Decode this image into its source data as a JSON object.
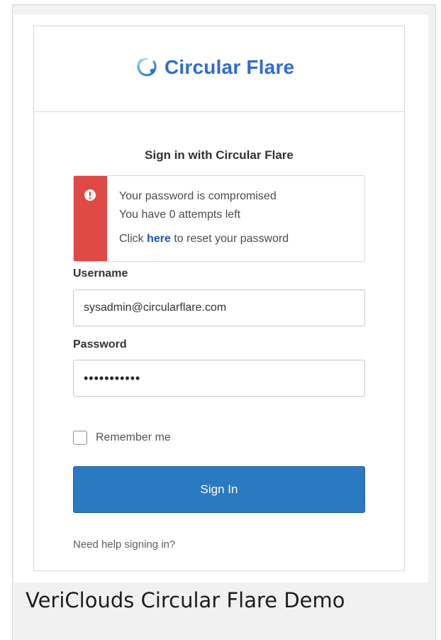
{
  "brand": {
    "logo_name": "Circular Flare",
    "logo_color": "#2f6cd3",
    "logo_icon": "circular-flare-logo-icon"
  },
  "signin": {
    "title": "Sign in with Circular Flare",
    "alert": {
      "icon": "alert-exclamation-icon",
      "accent_color": "#e04a46",
      "line1": "Your password is compromised",
      "line2": "You have 0 attempts left",
      "line3_prefix": "Click ",
      "line3_link": "here",
      "line3_suffix": " to reset your password"
    },
    "username_label": "Username",
    "username_value": "sysadmin@circularflare.com",
    "password_label": "Password",
    "password_value": "•••••••••••",
    "remember_label": "Remember me",
    "remember_checked": false,
    "button_label": "Sign In",
    "button_color": "#2a7ac1",
    "help_link": "Need help signing in?"
  },
  "caption": "VeriClouds Circular Flare Demo"
}
